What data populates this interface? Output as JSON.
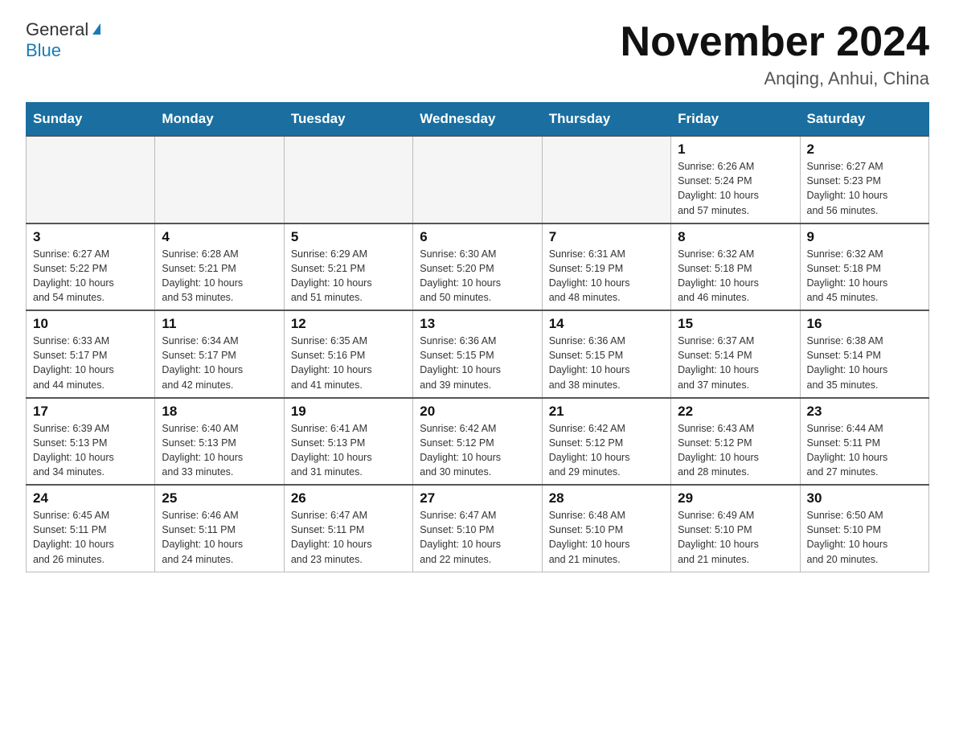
{
  "header": {
    "logo_text_general": "General",
    "logo_text_blue": "Blue",
    "title": "November 2024",
    "subtitle": "Anqing, Anhui, China"
  },
  "weekdays": [
    "Sunday",
    "Monday",
    "Tuesday",
    "Wednesday",
    "Thursday",
    "Friday",
    "Saturday"
  ],
  "weeks": [
    [
      {
        "day": "",
        "info": ""
      },
      {
        "day": "",
        "info": ""
      },
      {
        "day": "",
        "info": ""
      },
      {
        "day": "",
        "info": ""
      },
      {
        "day": "",
        "info": ""
      },
      {
        "day": "1",
        "info": "Sunrise: 6:26 AM\nSunset: 5:24 PM\nDaylight: 10 hours\nand 57 minutes."
      },
      {
        "day": "2",
        "info": "Sunrise: 6:27 AM\nSunset: 5:23 PM\nDaylight: 10 hours\nand 56 minutes."
      }
    ],
    [
      {
        "day": "3",
        "info": "Sunrise: 6:27 AM\nSunset: 5:22 PM\nDaylight: 10 hours\nand 54 minutes."
      },
      {
        "day": "4",
        "info": "Sunrise: 6:28 AM\nSunset: 5:21 PM\nDaylight: 10 hours\nand 53 minutes."
      },
      {
        "day": "5",
        "info": "Sunrise: 6:29 AM\nSunset: 5:21 PM\nDaylight: 10 hours\nand 51 minutes."
      },
      {
        "day": "6",
        "info": "Sunrise: 6:30 AM\nSunset: 5:20 PM\nDaylight: 10 hours\nand 50 minutes."
      },
      {
        "day": "7",
        "info": "Sunrise: 6:31 AM\nSunset: 5:19 PM\nDaylight: 10 hours\nand 48 minutes."
      },
      {
        "day": "8",
        "info": "Sunrise: 6:32 AM\nSunset: 5:18 PM\nDaylight: 10 hours\nand 46 minutes."
      },
      {
        "day": "9",
        "info": "Sunrise: 6:32 AM\nSunset: 5:18 PM\nDaylight: 10 hours\nand 45 minutes."
      }
    ],
    [
      {
        "day": "10",
        "info": "Sunrise: 6:33 AM\nSunset: 5:17 PM\nDaylight: 10 hours\nand 44 minutes."
      },
      {
        "day": "11",
        "info": "Sunrise: 6:34 AM\nSunset: 5:17 PM\nDaylight: 10 hours\nand 42 minutes."
      },
      {
        "day": "12",
        "info": "Sunrise: 6:35 AM\nSunset: 5:16 PM\nDaylight: 10 hours\nand 41 minutes."
      },
      {
        "day": "13",
        "info": "Sunrise: 6:36 AM\nSunset: 5:15 PM\nDaylight: 10 hours\nand 39 minutes."
      },
      {
        "day": "14",
        "info": "Sunrise: 6:36 AM\nSunset: 5:15 PM\nDaylight: 10 hours\nand 38 minutes."
      },
      {
        "day": "15",
        "info": "Sunrise: 6:37 AM\nSunset: 5:14 PM\nDaylight: 10 hours\nand 37 minutes."
      },
      {
        "day": "16",
        "info": "Sunrise: 6:38 AM\nSunset: 5:14 PM\nDaylight: 10 hours\nand 35 minutes."
      }
    ],
    [
      {
        "day": "17",
        "info": "Sunrise: 6:39 AM\nSunset: 5:13 PM\nDaylight: 10 hours\nand 34 minutes."
      },
      {
        "day": "18",
        "info": "Sunrise: 6:40 AM\nSunset: 5:13 PM\nDaylight: 10 hours\nand 33 minutes."
      },
      {
        "day": "19",
        "info": "Sunrise: 6:41 AM\nSunset: 5:13 PM\nDaylight: 10 hours\nand 31 minutes."
      },
      {
        "day": "20",
        "info": "Sunrise: 6:42 AM\nSunset: 5:12 PM\nDaylight: 10 hours\nand 30 minutes."
      },
      {
        "day": "21",
        "info": "Sunrise: 6:42 AM\nSunset: 5:12 PM\nDaylight: 10 hours\nand 29 minutes."
      },
      {
        "day": "22",
        "info": "Sunrise: 6:43 AM\nSunset: 5:12 PM\nDaylight: 10 hours\nand 28 minutes."
      },
      {
        "day": "23",
        "info": "Sunrise: 6:44 AM\nSunset: 5:11 PM\nDaylight: 10 hours\nand 27 minutes."
      }
    ],
    [
      {
        "day": "24",
        "info": "Sunrise: 6:45 AM\nSunset: 5:11 PM\nDaylight: 10 hours\nand 26 minutes."
      },
      {
        "day": "25",
        "info": "Sunrise: 6:46 AM\nSunset: 5:11 PM\nDaylight: 10 hours\nand 24 minutes."
      },
      {
        "day": "26",
        "info": "Sunrise: 6:47 AM\nSunset: 5:11 PM\nDaylight: 10 hours\nand 23 minutes."
      },
      {
        "day": "27",
        "info": "Sunrise: 6:47 AM\nSunset: 5:10 PM\nDaylight: 10 hours\nand 22 minutes."
      },
      {
        "day": "28",
        "info": "Sunrise: 6:48 AM\nSunset: 5:10 PM\nDaylight: 10 hours\nand 21 minutes."
      },
      {
        "day": "29",
        "info": "Sunrise: 6:49 AM\nSunset: 5:10 PM\nDaylight: 10 hours\nand 21 minutes."
      },
      {
        "day": "30",
        "info": "Sunrise: 6:50 AM\nSunset: 5:10 PM\nDaylight: 10 hours\nand 20 minutes."
      }
    ]
  ]
}
